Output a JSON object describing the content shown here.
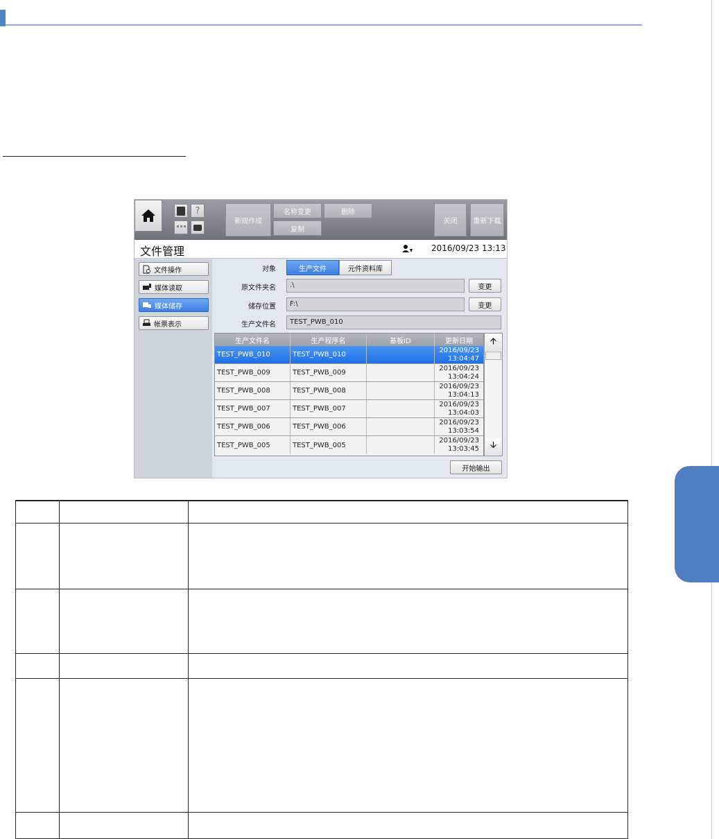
{
  "screen": {
    "toolbar": {
      "new_label": "新规作成",
      "rename_label": "名称变更",
      "delete_label": "删除",
      "copy_label": "复制",
      "close_label": "关闭",
      "redownload_label": "重新下载"
    },
    "title": "文件管理",
    "datetime": "2016/09/23 13:13",
    "nav": {
      "items": [
        {
          "label": "文件操作",
          "icon": "file-gear-icon",
          "active": false
        },
        {
          "label": "媒体读取",
          "icon": "media-read-icon",
          "active": false
        },
        {
          "label": "媒体储存",
          "icon": "media-save-icon",
          "active": true
        },
        {
          "label": "帐票表示",
          "icon": "printer-icon",
          "active": false
        }
      ]
    },
    "form": {
      "target_label": "对象",
      "target_options": [
        "生产文件",
        "元件资料库"
      ],
      "target_selected": "生产文件",
      "source_folder_label": "原文件夹名",
      "source_folder_value": ".\\",
      "save_location_label": "储存位置",
      "save_location_value": "F:\\",
      "production_file_label": "生产文件名",
      "production_file_value": "TEST_PWB_010",
      "change_label": "变更"
    },
    "table": {
      "columns": [
        "生产文件名",
        "生产程序名",
        "基板ID",
        "更新日期"
      ],
      "rows": [
        {
          "file": "TEST_PWB_010",
          "program": "TEST_PWB_010",
          "board_id": "",
          "date": "2016/09/23",
          "time": "13:04:47",
          "selected": true
        },
        {
          "file": "TEST_PWB_009",
          "program": "TEST_PWB_009",
          "board_id": "",
          "date": "2016/09/23",
          "time": "13:04:24",
          "selected": false
        },
        {
          "file": "TEST_PWB_008",
          "program": "TEST_PWB_008",
          "board_id": "",
          "date": "2016/09/23",
          "time": "13:04:13",
          "selected": false
        },
        {
          "file": "TEST_PWB_007",
          "program": "TEST_PWB_007",
          "board_id": "",
          "date": "2016/09/23",
          "time": "13:04:03",
          "selected": false
        },
        {
          "file": "TEST_PWB_006",
          "program": "TEST_PWB_006",
          "board_id": "",
          "date": "2016/09/23",
          "time": "13:03:54",
          "selected": false
        },
        {
          "file": "TEST_PWB_005",
          "program": "TEST_PWB_005",
          "board_id": "",
          "date": "2016/09/23",
          "time": "13:03:45",
          "selected": false
        }
      ]
    },
    "start_output_label": "开始输出"
  },
  "colors": {
    "accent": "#4f86c6",
    "selected_row": "#1e70e6",
    "side_tab": "#4f7fc0"
  }
}
